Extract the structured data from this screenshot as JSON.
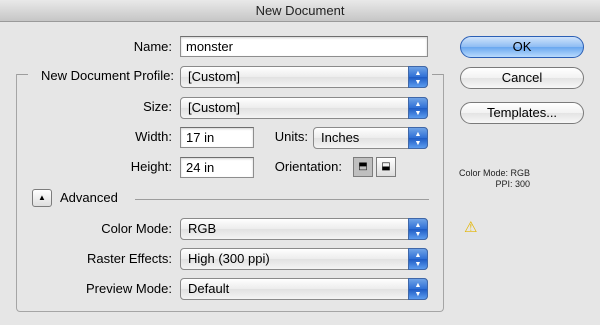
{
  "window": {
    "title": "New Document"
  },
  "form": {
    "name_label": "Name:",
    "name_value": "monster",
    "profile_label": "New Document Profile:",
    "profile_value": "[Custom]",
    "size_label": "Size:",
    "size_value": "[Custom]",
    "width_label": "Width:",
    "width_value": "17 in",
    "units_label": "Units:",
    "units_value": "Inches",
    "height_label": "Height:",
    "height_value": "24 in",
    "orientation_label": "Orientation:",
    "orientation_selected": "portrait",
    "advanced_label": "Advanced",
    "color_mode_label": "Color Mode:",
    "color_mode_value": "RGB",
    "raster_label": "Raster Effects:",
    "raster_value": "High (300 ppi)",
    "preview_label": "Preview Mode:",
    "preview_value": "Default"
  },
  "buttons": {
    "ok": "OK",
    "cancel": "Cancel",
    "templates": "Templates..."
  },
  "info": {
    "color_mode": "Color Mode: RGB",
    "ppi": "PPI: 300"
  },
  "icons": {
    "popup_arrows": "up-down-arrows-icon",
    "advanced_toggle": "triangle-up-icon",
    "portrait": "portrait-orientation-icon",
    "landscape": "landscape-orientation-icon",
    "warning": "warning-icon"
  },
  "colors": {
    "default_button": "#8ebcf3",
    "warning": "#e3b500",
    "popup_accent": "#2e6fd6"
  }
}
